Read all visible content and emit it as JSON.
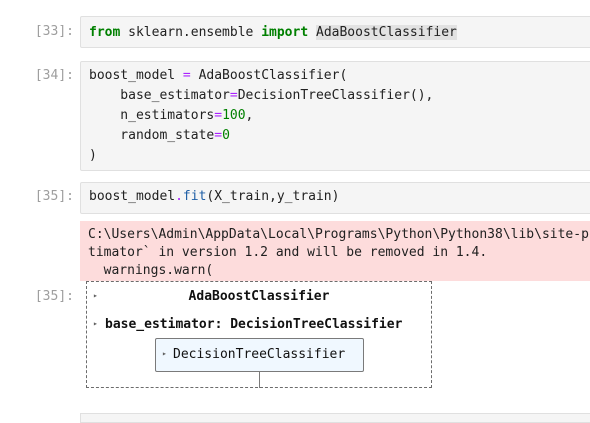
{
  "cells": [
    {
      "prompt": "[33]:",
      "lines": [
        [
          {
            "t": "from",
            "c": "kw"
          },
          {
            "t": " sklearn.ensemble ",
            "c": ""
          },
          {
            "t": "import",
            "c": "kw"
          },
          {
            "t": " ",
            "c": ""
          },
          {
            "t": "AdaBoostClassifier",
            "c": "hl"
          }
        ]
      ]
    },
    {
      "prompt": "[34]:",
      "lines": [
        [
          {
            "t": "boost_model ",
            "c": ""
          },
          {
            "t": "=",
            "c": "op"
          },
          {
            "t": " AdaBoostClassifier(",
            "c": ""
          }
        ],
        [
          {
            "t": "    base_estimator",
            "c": ""
          },
          {
            "t": "=",
            "c": "op"
          },
          {
            "t": "DecisionTreeClassifier(),",
            "c": ""
          }
        ],
        [
          {
            "t": "    n_estimators",
            "c": ""
          },
          {
            "t": "=",
            "c": "op"
          },
          {
            "t": "100",
            "c": "num"
          },
          {
            "t": ",",
            "c": ""
          }
        ],
        [
          {
            "t": "    random_state",
            "c": ""
          },
          {
            "t": "=",
            "c": "op"
          },
          {
            "t": "0",
            "c": "num"
          }
        ],
        [
          {
            "t": ")",
            "c": ""
          }
        ]
      ]
    },
    {
      "prompt": "[35]:",
      "lines": [
        [
          {
            "t": "boost_model",
            "c": ""
          },
          {
            "t": ".",
            "c": "op"
          },
          {
            "t": "fit",
            "c": "fn"
          },
          {
            "t": "(X_train,y_train)",
            "c": ""
          }
        ]
      ]
    }
  ],
  "stderr": {
    "lines": [
      "C:\\Users\\Admin\\AppData\\Local\\Programs\\Python\\Python38\\lib\\site-p",
      "timator` in version 1.2 and will be removed in 1.4.",
      "  warnings.warn("
    ]
  },
  "output": {
    "prompt": "[35]:",
    "estimator_title": "AdaBoostClassifier",
    "param_label": "base_estimator: DecisionTreeClassifier",
    "inner_label": "DecisionTreeClassifier",
    "toggle_icon": "triangle-right-icon",
    "toggle_glyph": "▸"
  },
  "colors": {
    "keyword": "#008000",
    "stderr_bg": "#fddcdc",
    "estimator_bg": "#f0f8ff"
  }
}
